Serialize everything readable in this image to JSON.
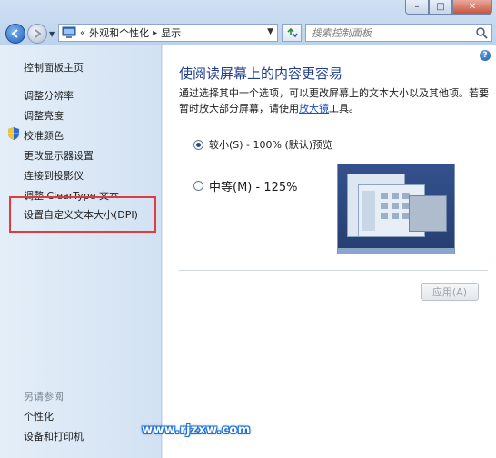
{
  "window": {
    "minimize_glyph": "–",
    "maximize_glyph": "□",
    "close_glyph": "✕"
  },
  "address_bar": {
    "prefix": "«",
    "crumbs": [
      "外观和个性化",
      "显示"
    ],
    "separator": "▸"
  },
  "search": {
    "placeholder": "搜索控制面板"
  },
  "sidebar": {
    "home": "控制面板主页",
    "items": [
      "调整分辨率",
      "调整亮度",
      "校准颜色",
      "更改显示器设置",
      "连接到投影仪",
      "调整 ClearType 文本",
      "设置自定义文本大小(DPI)"
    ],
    "see_also_label": "另请参阅",
    "see_also_items": [
      "个性化",
      "设备和打印机"
    ]
  },
  "main": {
    "title": "使阅读屏幕上的内容更容易",
    "description_before_link": "通过选择其中一个选项，可以更改屏幕上的文本大小以及其他项。若要暂时放大部分屏幕，请使用",
    "description_link": "放大镜",
    "description_after_link": "工具。",
    "options": [
      {
        "label": "较小(S) - 100% (默认)",
        "selected": true
      },
      {
        "label": "中等(M) - 125%",
        "selected": false
      }
    ],
    "preview_label": "预览",
    "apply_button": "应用(A)"
  },
  "watermark": "www.rjzxw.com",
  "colors": {
    "title": "#1e3d8c",
    "link": "#1f4fbf",
    "highlight": "#e33b3b",
    "sidebar_bg": "#dce8f5"
  }
}
